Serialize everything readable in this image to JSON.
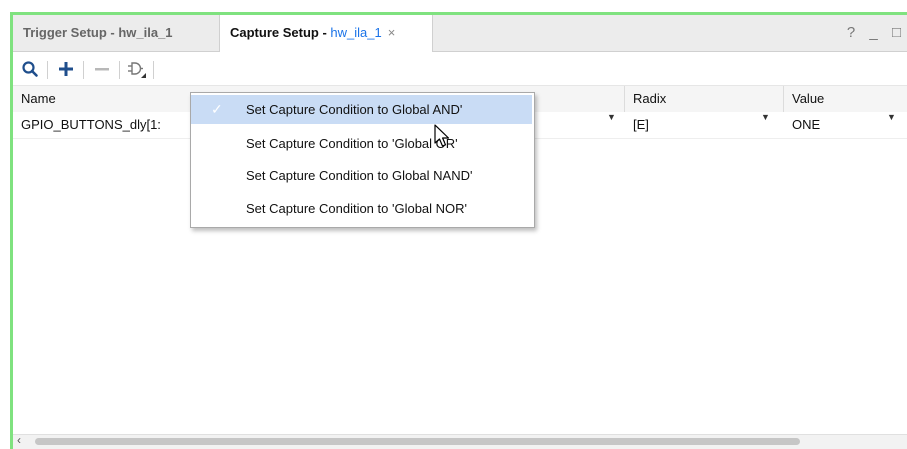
{
  "tabs": [
    {
      "label": "Trigger Setup - hw_ila_1"
    },
    {
      "label_main": "Capture Setup - ",
      "label_sub": "hw_ila_1",
      "close": "×"
    }
  ],
  "window_controls": {
    "help": "?",
    "minimize": "_",
    "maximize": "□"
  },
  "toolbar": {
    "items": [
      "search-icon",
      "add-icon",
      "remove-icon",
      "capture-condition-gate-icon"
    ]
  },
  "table": {
    "columns": [
      "Name",
      "Radix",
      "Value"
    ],
    "rows": [
      {
        "name": "GPIO_BUTTONS_dly[1:",
        "radix": "[E]",
        "value": "ONE"
      }
    ]
  },
  "context_menu": {
    "items": [
      {
        "label": "Set Capture Condition to Global AND'",
        "checked": true
      },
      {
        "label": "Set Capture Condition to 'Global OR'",
        "checked": false
      },
      {
        "label": "Set Capture Condition to Global NAND'",
        "checked": false
      },
      {
        "label": "Set Capture Condition to 'Global NOR'",
        "checked": false
      }
    ],
    "check_glyph": "✓"
  },
  "colors": {
    "accent_border": "#7fe27f",
    "selection": "#c9dcf5",
    "link": "#1a73e8"
  }
}
